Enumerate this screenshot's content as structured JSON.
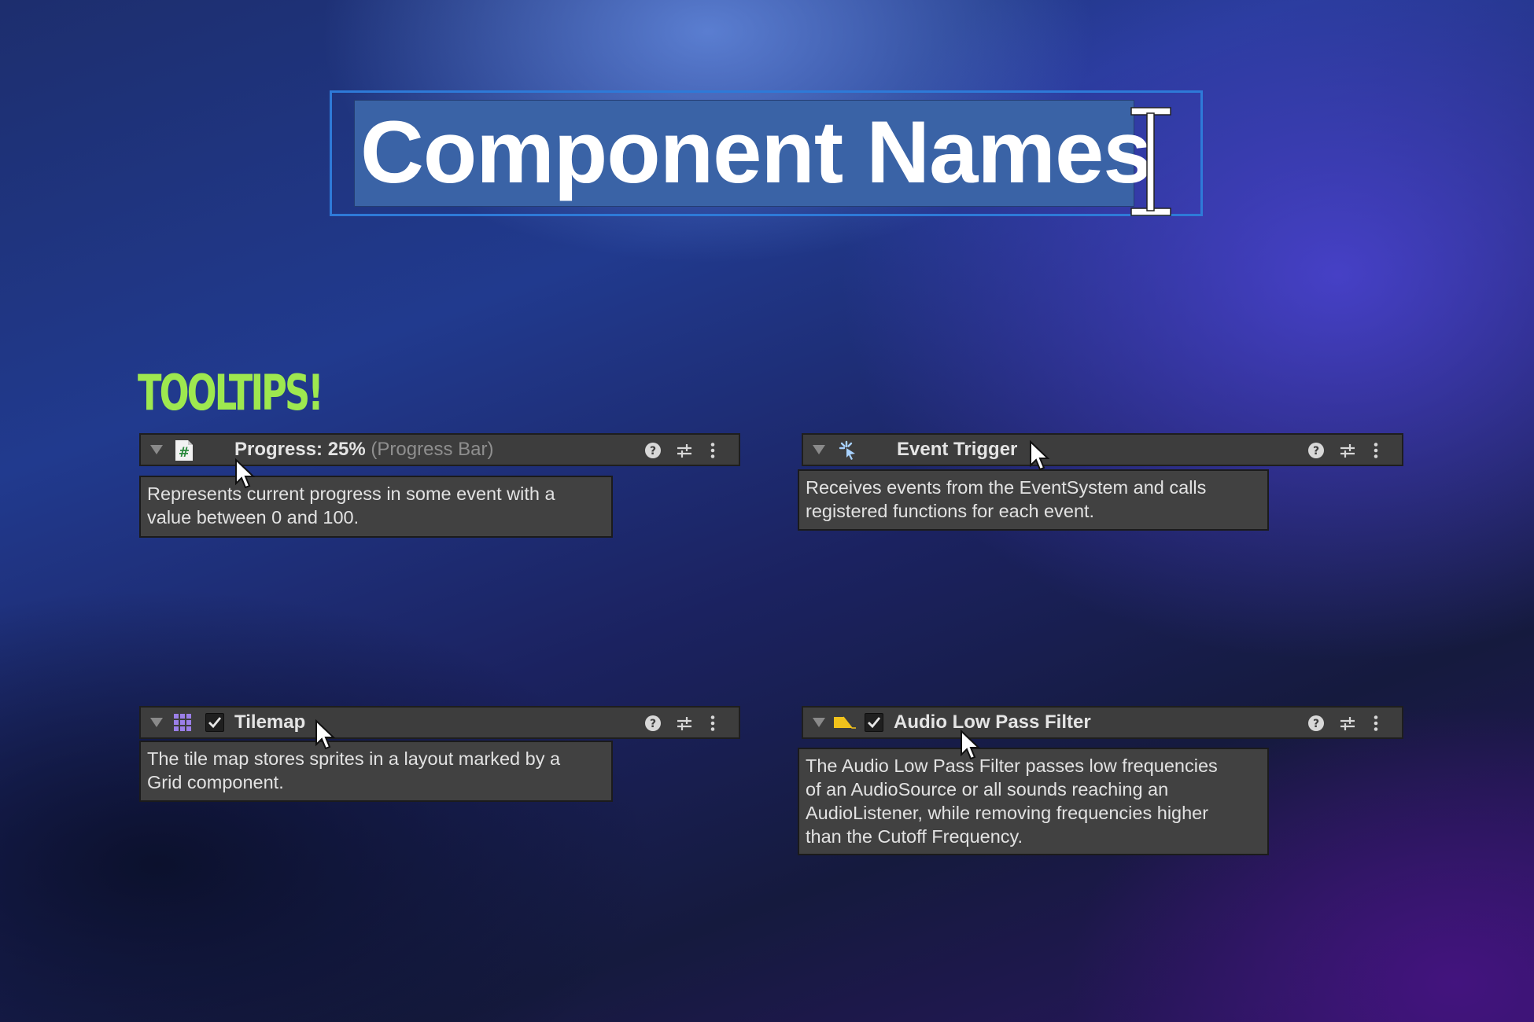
{
  "title": {
    "text": "Component Names"
  },
  "section_heading": "TOOLTIPS!",
  "components": [
    {
      "name": "Progress: 25%",
      "subtitle": "(Progress Bar)",
      "icon": "script-hash-icon",
      "has_checkbox": false,
      "tooltip_lines": [
        "Represents current progress in some event with a",
        "value between 0 and 100."
      ]
    },
    {
      "name": "Event Trigger",
      "subtitle": "",
      "icon": "event-trigger-icon",
      "has_checkbox": false,
      "tooltip_lines": [
        "Receives events from the EventSystem and calls",
        "registered functions for each event."
      ]
    },
    {
      "name": "Tilemap",
      "subtitle": "",
      "icon": "tilemap-grid-icon",
      "has_checkbox": true,
      "checked": true,
      "tooltip_lines": [
        "The tile map stores sprites in a layout marked by a",
        "Grid component."
      ]
    },
    {
      "name": "Audio Low Pass Filter",
      "subtitle": "",
      "icon": "audio-filter-icon",
      "has_checkbox": true,
      "checked": true,
      "tooltip_lines": [
        "The Audio Low Pass Filter passes low frequencies",
        "of an AudioSource or all sounds reaching an",
        "AudioListener, while removing frequencies higher",
        "than the Cutoff Frequency."
      ]
    }
  ],
  "colors": {
    "heading_green": "#9ee84f",
    "title_selection": "#3a63a6",
    "title_frame": "#2e7ad8",
    "panel_bg": "#3d3d3d",
    "tooltip_bg": "#414141"
  }
}
